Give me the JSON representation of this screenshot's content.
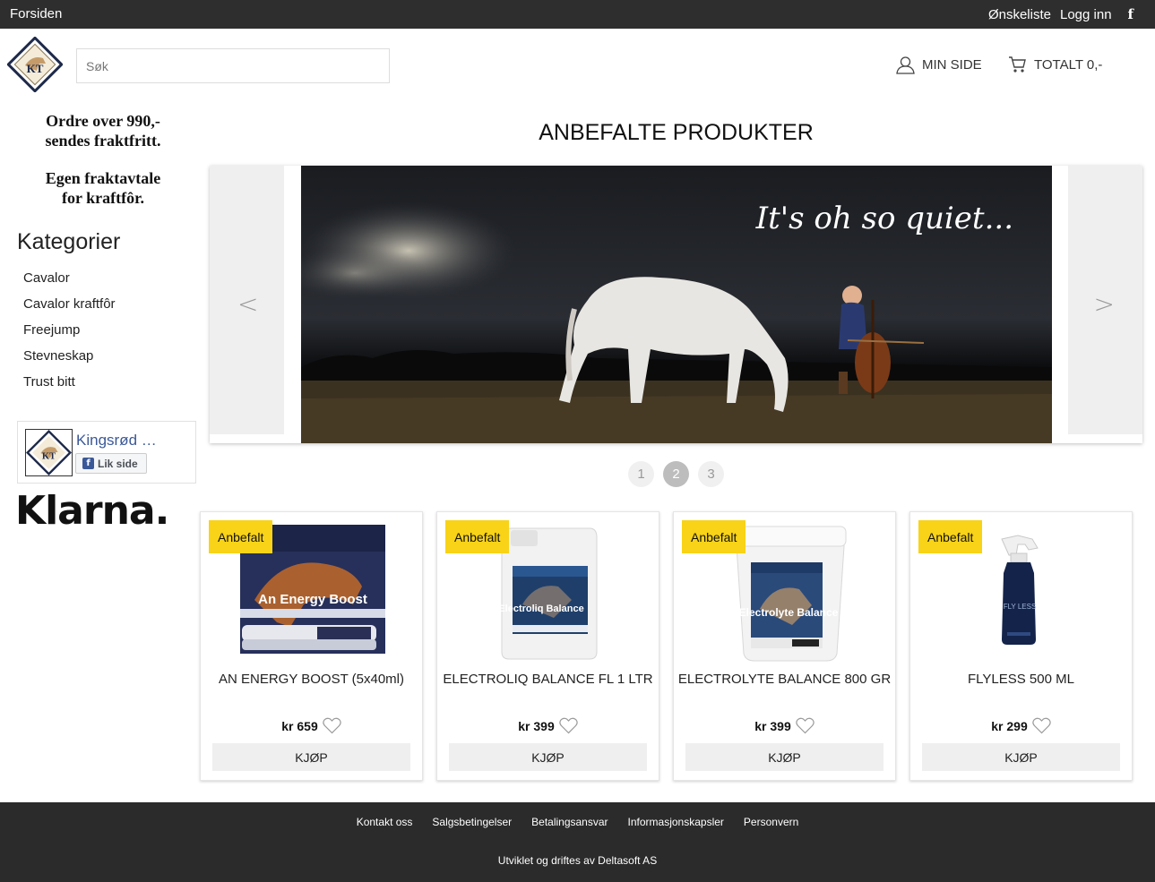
{
  "topbar": {
    "home": "Forsiden",
    "wishlist": "Ønskeliste",
    "login": "Logg inn",
    "facebook": "f"
  },
  "header": {
    "logo_text": "KT",
    "search_placeholder": "Søk",
    "my_page": "MIN SIDE",
    "cart_total": "TOTALT 0,-"
  },
  "sidebar": {
    "shipping_line1": "Ordre over 990,-",
    "shipping_line2": "sendes fraktfritt.",
    "shipping_line3": "Egen fraktavtale",
    "shipping_line4": "for kraftfôr.",
    "categories_title": "Kategorier",
    "categories": [
      "Cavalor",
      "Cavalor kraftfôr",
      "Freejump",
      "Stevneskap",
      "Trust bitt"
    ],
    "facebook_page": "Kingsrød …",
    "facebook_like": "Lik side",
    "klarna": "Klarna."
  },
  "main": {
    "title": "ANBEFALTE PRODUKTER",
    "slide_text": "It's oh so quiet...",
    "prev": "<",
    "next": ">",
    "dots": [
      "1",
      "2",
      "3"
    ],
    "active_dot": 2
  },
  "products": [
    {
      "badge": "Anbefalt",
      "name": "AN ENERGY BOOST (5x40ml)",
      "price": "kr 659",
      "buy": "KJØP",
      "pkg_text": "An Energy Boost"
    },
    {
      "badge": "Anbefalt",
      "name": "ELECTROLIQ BALANCE FL 1 LTR",
      "price": "kr 399",
      "buy": "KJØP",
      "pkg_text": "Electroliq Balance"
    },
    {
      "badge": "Anbefalt",
      "name": "ELECTROLYTE BALANCE 800 GR",
      "price": "kr 399",
      "buy": "KJØP",
      "pkg_text": "Electrolyte Balance"
    },
    {
      "badge": "Anbefalt",
      "name": "FLYLESS 500 ML",
      "price": "kr 299",
      "buy": "KJØP",
      "pkg_text": "FLY LESS"
    }
  ],
  "footer": {
    "links": [
      "Kontakt oss",
      "Salgsbetingelser",
      "Betalingsansvar",
      "Informasjonskapsler",
      "Personvern"
    ],
    "credit": "Utviklet og driftes av Deltasoft AS"
  },
  "colors": {
    "topbar": "#2e2e2e",
    "badge": "#f8d317",
    "footer": "#2b2b2b",
    "facebook": "#3b5998"
  }
}
